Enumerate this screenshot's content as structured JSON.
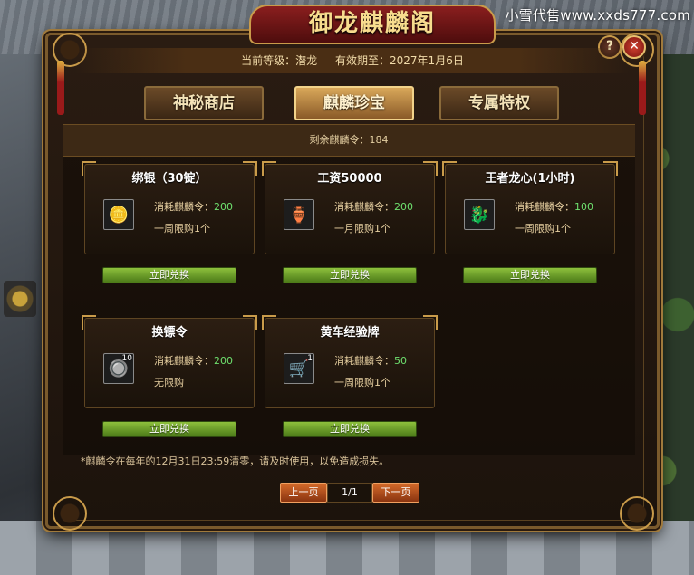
{
  "watermark": "小雪代售www.xxds777.com",
  "window": {
    "title": "御龙麒麟阁",
    "help_glyph": "?",
    "close_glyph": "✕"
  },
  "header": {
    "level_label": "当前等级：潜龙",
    "expiry_label": "有效期至：2027年1月6日"
  },
  "tabs": [
    {
      "label": "神秘商店",
      "active": false
    },
    {
      "label": "麒麟珍宝",
      "active": true
    },
    {
      "label": "专属特权",
      "active": false
    }
  ],
  "tokens": {
    "label": "剩余麒麟令：184"
  },
  "items": [
    {
      "name": "绑银（30锭）",
      "cost_label": "消耗麒麟令：",
      "cost": "200",
      "limit": "一周限购1个",
      "icon": "silver-ingot-icon",
      "count": "",
      "button": "立即兑换"
    },
    {
      "name": "工资50000",
      "cost_label": "消耗麒麟令：",
      "cost": "200",
      "limit": "一月限购1个",
      "icon": "gold-pot-icon",
      "count": "",
      "button": "立即兑换"
    },
    {
      "name": "王者龙心(1小时)",
      "cost_label": "消耗麒麟令：",
      "cost": "100",
      "limit": "一周限购1个",
      "icon": "dragon-heart-icon",
      "count": "",
      "button": "立即兑换"
    },
    {
      "name": "换镖令",
      "cost_label": "消耗麒麟令：",
      "cost": "200",
      "limit": "无限购",
      "icon": "escort-token-icon",
      "count": "10",
      "button": "立即兑换"
    },
    {
      "name": "黄车经验牌",
      "cost_label": "消耗麒麟令：",
      "cost": "50",
      "limit": "一周限购1个",
      "icon": "cart-exp-icon",
      "count": "1",
      "button": "立即兑换"
    }
  ],
  "note": "*麒麟令在每年的12月31日23:59清零，请及时使用，以免造成损失。",
  "pager": {
    "prev": "上一页",
    "page": "1/1",
    "next": "下一页"
  }
}
